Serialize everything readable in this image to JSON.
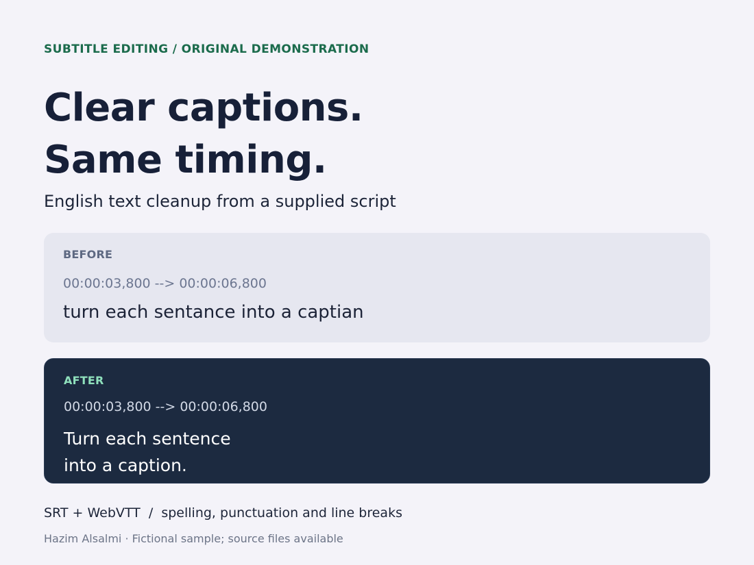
{
  "eyebrow": "SUBTITLE EDITING / ORIGINAL DEMONSTRATION",
  "headline": {
    "line1": "Clear captions.",
    "line2": "Same timing."
  },
  "subtitle": "English text cleanup from a supplied script",
  "before": {
    "label": "BEFORE",
    "timecode": "00:00:03,800 --> 00:00:06,800",
    "caption": "turn each sentance into a captian"
  },
  "after": {
    "label": "AFTER",
    "timecode": "00:00:03,800 --> 00:00:06,800",
    "caption_line1": "Turn each sentence",
    "caption_line2": "into a caption."
  },
  "features": "SRT + WebVTT  /  spelling, punctuation and line breaks",
  "credit": {
    "author": "Hazim Alsalmi",
    "separator": " · ",
    "note": "Fictional sample; source files available"
  },
  "colors": {
    "background": "#f4f3f9",
    "accent_green": "#1b6b4c",
    "after_label": "#8fe0bc",
    "after_card": "#1c2a40",
    "before_card": "#e6e7f0",
    "heading": "#172038"
  }
}
